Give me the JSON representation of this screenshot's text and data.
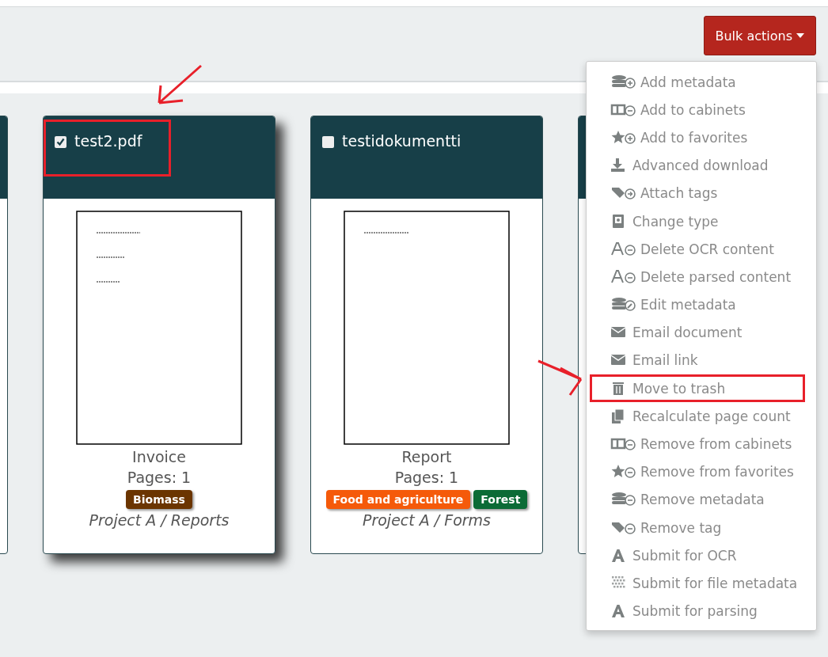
{
  "bulk_actions_button": {
    "label": "Bulk actions",
    "expanded": true
  },
  "documents": [
    {
      "title": "test2.pdf",
      "checked": true,
      "type": "Invoice",
      "pages": "Pages: 1",
      "tags": [
        {
          "label": "Biomass",
          "color": "#6b3500"
        }
      ],
      "location": "Project A / Reports"
    },
    {
      "title": "testidokumentti",
      "checked": false,
      "type": "Report",
      "pages": "Pages: 1",
      "tags": [
        {
          "label": "Food and agriculture",
          "color": "#f55a0a"
        },
        {
          "label": "Forest",
          "color": "#0b6b36"
        }
      ],
      "location": "Project A / Forms"
    }
  ],
  "bulk_menu": [
    {
      "label": "Add metadata",
      "kind": "dbplus"
    },
    {
      "label": "Add to cabinets",
      "kind": "cabinet"
    },
    {
      "label": "Add to favorites",
      "kind": "starplus"
    },
    {
      "label": "Advanced download",
      "kind": "download"
    },
    {
      "label": "Attach tags",
      "kind": "tagarrow"
    },
    {
      "label": "Change type",
      "kind": "typecard"
    },
    {
      "label": "Delete OCR content",
      "kind": "fontminus"
    },
    {
      "label": "Delete parsed content",
      "kind": "fontminus"
    },
    {
      "label": "Edit metadata",
      "kind": "dbedit"
    },
    {
      "label": "Email document",
      "kind": "envelope"
    },
    {
      "label": "Email link",
      "kind": "envelope"
    },
    {
      "label": "Move to trash",
      "kind": "trash",
      "highlighted": true
    },
    {
      "label": "Recalculate page count",
      "kind": "copy"
    },
    {
      "label": "Remove from cabinets",
      "kind": "cabinet"
    },
    {
      "label": "Remove from favorites",
      "kind": "starminus"
    },
    {
      "label": "Remove metadata",
      "kind": "dbminus"
    },
    {
      "label": "Remove tag",
      "kind": "tagminus"
    },
    {
      "label": "Submit for OCR",
      "kind": "font"
    },
    {
      "label": "Submit for file metadata",
      "kind": "checker"
    },
    {
      "label": "Submit for parsing",
      "kind": "font"
    }
  ]
}
